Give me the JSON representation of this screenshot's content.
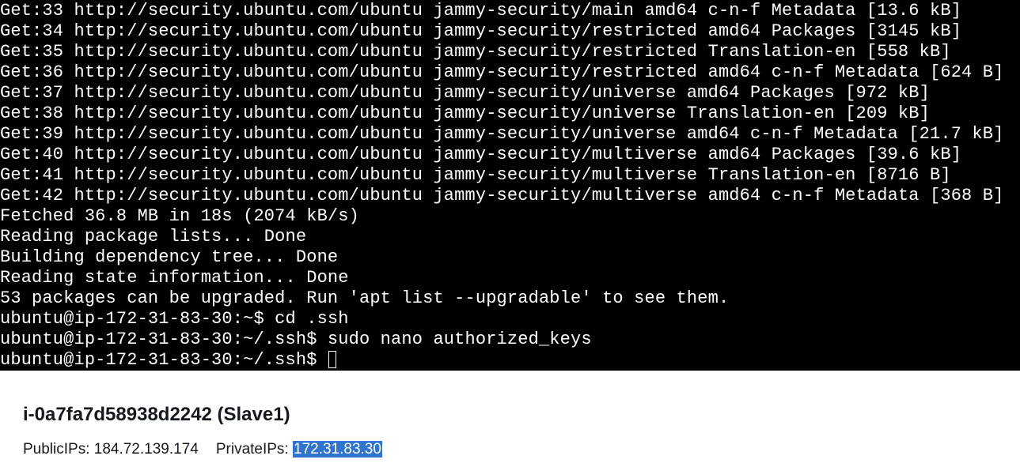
{
  "terminal": {
    "lines": [
      "Get:33 http://security.ubuntu.com/ubuntu jammy-security/main amd64 c-n-f Metadata [13.6 kB]",
      "Get:34 http://security.ubuntu.com/ubuntu jammy-security/restricted amd64 Packages [3145 kB]",
      "Get:35 http://security.ubuntu.com/ubuntu jammy-security/restricted Translation-en [558 kB]",
      "Get:36 http://security.ubuntu.com/ubuntu jammy-security/restricted amd64 c-n-f Metadata [624 B]",
      "Get:37 http://security.ubuntu.com/ubuntu jammy-security/universe amd64 Packages [972 kB]",
      "Get:38 http://security.ubuntu.com/ubuntu jammy-security/universe Translation-en [209 kB]",
      "Get:39 http://security.ubuntu.com/ubuntu jammy-security/universe amd64 c-n-f Metadata [21.7 kB]",
      "Get:40 http://security.ubuntu.com/ubuntu jammy-security/multiverse amd64 Packages [39.6 kB]",
      "Get:41 http://security.ubuntu.com/ubuntu jammy-security/multiverse Translation-en [8716 B]",
      "Get:42 http://security.ubuntu.com/ubuntu jammy-security/multiverse amd64 c-n-f Metadata [368 B]",
      "Fetched 36.8 MB in 18s (2074 kB/s)",
      "Reading package lists... Done",
      "Building dependency tree... Done",
      "Reading state information... Done",
      "53 packages can be upgraded. Run 'apt list --upgradable' to see them.",
      "ubuntu@ip-172-31-83-30:~$ cd .ssh",
      "ubuntu@ip-172-31-83-30:~/.ssh$ sudo nano authorized_keys"
    ],
    "prompt": "ubuntu@ip-172-31-83-30:~/.ssh$"
  },
  "instance": {
    "title": "i-0a7fa7d58938d2242 (Slave1)",
    "public_ips_label": "PublicIPs:",
    "public_ip": "184.72.139.174",
    "private_ips_label": "PrivateIPs:",
    "private_ip": "172.31.83.30"
  },
  "colors": {
    "terminal_bg": "#000000",
    "terminal_fg": "#ffffff",
    "selection_bg": "#2f74d0"
  }
}
